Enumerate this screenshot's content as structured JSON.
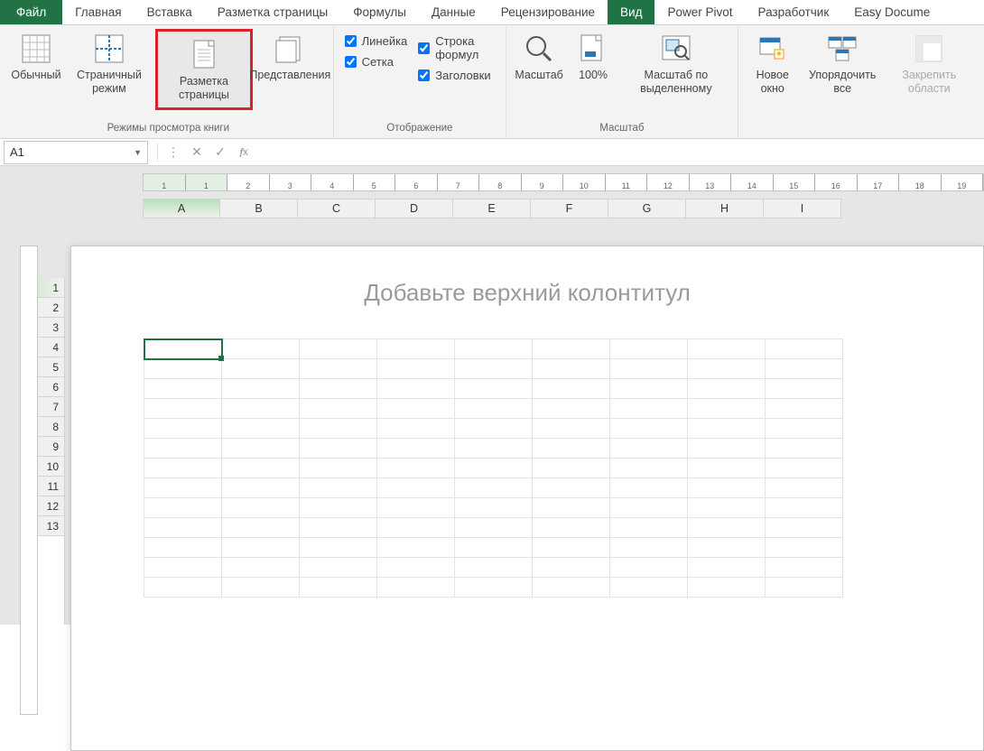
{
  "menu": {
    "tabs": [
      "Файл",
      "Главная",
      "Вставка",
      "Разметка страницы",
      "Формулы",
      "Данные",
      "Рецензирование",
      "Вид",
      "Power Pivot",
      "Разработчик",
      "Easy Docume"
    ],
    "active_index": 7
  },
  "ribbon": {
    "group1": {
      "label": "Режимы просмотра книги",
      "buttons": [
        "Обычный",
        "Страничный режим",
        "Разметка страницы",
        "Представления"
      ]
    },
    "group2": {
      "label": "Отображение",
      "checks": {
        "ruler": "Линейка",
        "formula_bar": "Строка формул",
        "grid": "Сетка",
        "headings": "Заголовки"
      }
    },
    "group3": {
      "label": "Масштаб",
      "buttons": [
        "Масштаб",
        "100%",
        "Масштаб по выделенному"
      ]
    },
    "group4": {
      "buttons": [
        "Новое окно",
        "Упорядочить все",
        "Закрепить области"
      ]
    }
  },
  "namebox": {
    "value": "A1"
  },
  "columns": [
    "A",
    "B",
    "C",
    "D",
    "E",
    "F",
    "G",
    "H",
    "I"
  ],
  "rows": [
    "1",
    "2",
    "3",
    "4",
    "5",
    "6",
    "7",
    "8",
    "9",
    "10",
    "11",
    "12",
    "13"
  ],
  "ruler_numbers": [
    "1",
    "1",
    "2",
    "3",
    "4",
    "5",
    "6",
    "7",
    "8",
    "9",
    "10",
    "11",
    "12",
    "13",
    "14",
    "15",
    "16",
    "17",
    "18",
    "19"
  ],
  "header_placeholder": "Добавьте верхний колонтитул"
}
